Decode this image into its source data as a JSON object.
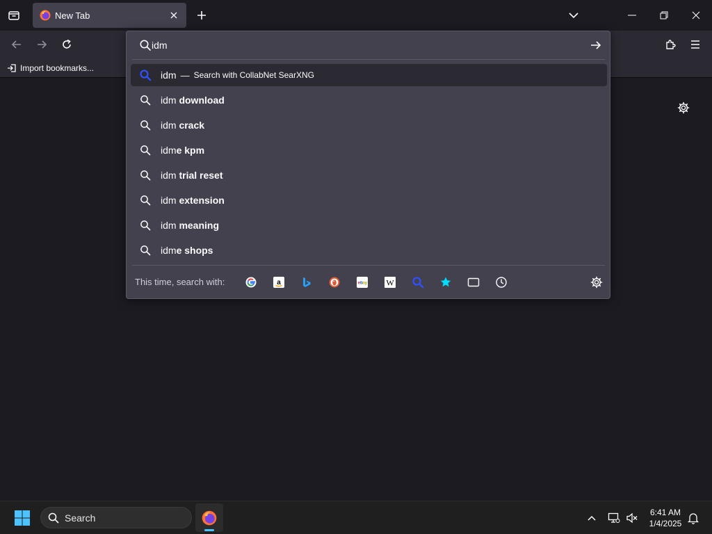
{
  "tabs": {
    "active_title": "New Tab"
  },
  "bookmarks": {
    "import_label": "Import bookmarks..."
  },
  "urlbar": {
    "value": "idm",
    "first_result": {
      "query": "idm",
      "separator": "—",
      "engine_text": "Search with CollabNet SearXNG"
    },
    "suggestions": [
      {
        "prefix": "idm",
        "bold": " download"
      },
      {
        "prefix": "idm",
        "bold": " crack"
      },
      {
        "prefix": "idm",
        "bold": "e kpm"
      },
      {
        "prefix": "idm",
        "bold": " trial reset"
      },
      {
        "prefix": "idm",
        "bold": " extension"
      },
      {
        "prefix": "idm",
        "bold": " meaning"
      },
      {
        "prefix": "idm",
        "bold": "e shops"
      }
    ],
    "oneoff_label": "This time, search with:",
    "oneoff_engines": [
      "google-icon",
      "amazon-icon",
      "bing-icon",
      "duckduckgo-icon",
      "ebay-icon",
      "wikipedia-icon",
      "searxng-icon",
      "bookmarks-star-icon",
      "tabs-icon",
      "history-icon"
    ]
  },
  "taskbar": {
    "search_label": "Search",
    "time": "6:41 AM",
    "date": "1/4/2025"
  },
  "colors": {
    "accent_blue": "#4cc2ff",
    "popup_bg": "#42414d",
    "selected_row": "#2b2a33"
  }
}
